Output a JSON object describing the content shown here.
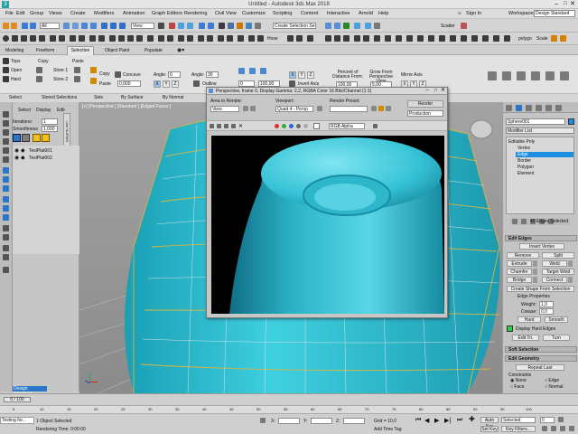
{
  "app": {
    "title": "Untitled - Autodesk 3ds Max 2018",
    "sign_in": "Sign In",
    "workspaces_label": "Workspaces:",
    "workspace": "Design Standard"
  },
  "menu": [
    "File",
    "Edit",
    "Group",
    "Views",
    "Create",
    "Modifiers",
    "Animation",
    "Graph Editors",
    "Rendering",
    "Civil View",
    "Customize",
    "Scripting",
    "Content",
    "Interactive",
    "Arnold",
    "Help"
  ],
  "ribbon_tabs": [
    "Modeling",
    "Freeform",
    "Selection",
    "Object Paint",
    "Populate"
  ],
  "ribbon": {
    "tops": "Tops",
    "open": "Open",
    "hard": "Hard",
    "copy_a": "Copy",
    "store1": "Store 1",
    "store2": "Store 2",
    "paste": "Paste",
    "select": "Select",
    "stored_selections": "Stored Selections",
    "copy_b": "Copy",
    "paste_b": "Paste",
    "sets": "Sets",
    "concave": "Concave",
    "by_surface_val": "0,000",
    "by_surface": "By Surface",
    "angle1_label": "Angle:",
    "angle1": "0",
    "angle2_label": "Angle:",
    "angle2": "30",
    "outline": "Outline",
    "by_normal": "By Normal",
    "xyz": [
      "X",
      "Y",
      "Z"
    ],
    "invert_axis": "Invert Axis",
    "percent_label": "Percent of Distance From:",
    "percent_val": "100,00",
    "grow_label": "Grow From Perspective View",
    "grow_val": "5,00",
    "mirror": "Mirror Axis",
    "frame_val": "0",
    "pivot_val": "100,00"
  },
  "left_panel": {
    "tabs": [
      "Select",
      "Display",
      "Edit"
    ],
    "iterations_label": "Iterations:",
    "iterations": "1",
    "smoothness_label": "Smoothness",
    "smoothness": "1,000",
    "scene_items": [
      "TeslPlat001",
      "TeslPlat002"
    ],
    "design_standard": "Design Standard"
  },
  "viewport": {
    "label": "[+] [Perspective ] [Standard ] [Edged Faces ]"
  },
  "render_window": {
    "title": "Perspective, frame 0, Display Gamma: 2,2, RGBA Color 16 Bits/Channel (1:1)",
    "area_label": "Area to Render:",
    "area_value": "View",
    "viewport_label": "Viewport:",
    "viewport_value": "Quad 4 - Persp",
    "preset_label": "Render Preset:",
    "preset_value": "",
    "render_btn": "Render",
    "production": "Production",
    "channel": "RGB Alpha"
  },
  "command_panel": {
    "object_name": "Sphere001",
    "modifier_list": "Modifier List",
    "stack": [
      "Editable Poly",
      "Vertex",
      "Edge",
      "Border",
      "Polygon",
      "Element"
    ],
    "selected_stack_index": 2,
    "edges_selected": "40 Edges Selected",
    "edit_edges": "Edit Edges",
    "insert_vertex": "Insert Vertex",
    "remove": "Remove",
    "split": "Split",
    "extrude": "Extrude",
    "weld": "Weld",
    "chamfer": "Chamfer",
    "target_weld": "Target Weld",
    "bridge": "Bridge",
    "connect": "Connect",
    "create_shape": "Create Shape From Selection",
    "edge_properties": "Edge Properties",
    "weight_label": "Weight:",
    "weight": "1,0",
    "crease_label": "Crease:",
    "crease": "0,0",
    "hard": "Hard",
    "smooth": "Smooth",
    "display_hard": "Display Hard Edges",
    "edit_tri": "Edit Tri.",
    "turn": "Turn",
    "soft_selection": "Soft Selection",
    "edit_geometry": "Edit Geometry",
    "repeat_last": "Repeat Last",
    "constraints": "Constraints",
    "c_none": "None",
    "c_edge": "Edge",
    "c_face": "Face",
    "c_normal": "Normal"
  },
  "status": {
    "timeline": "0 / 100",
    "object_selected": "1 Object Selected",
    "rendering_time": "Rendering Time: 0:00:00",
    "maxscript": "Testing for...",
    "x_label": "X:",
    "y_label": "Y:",
    "z_label": "Z:",
    "grid": "Grid = 10,0",
    "add_time_tag": "Add Time Tag",
    "auto_key": "Auto Key",
    "selected": "Selected",
    "set_key": "Set Key",
    "key_filters": "Key Filters...",
    "frame": "0",
    "ticks": [
      "5",
      "10",
      "15",
      "20",
      "25",
      "30",
      "35",
      "40",
      "45",
      "50",
      "55",
      "60",
      "65",
      "70",
      "75",
      "80",
      "85",
      "90",
      "95",
      "100"
    ]
  },
  "colors": {
    "accent": "#1c8fe0",
    "object": "#35c7d8",
    "selected_edge": "#e0b020"
  }
}
